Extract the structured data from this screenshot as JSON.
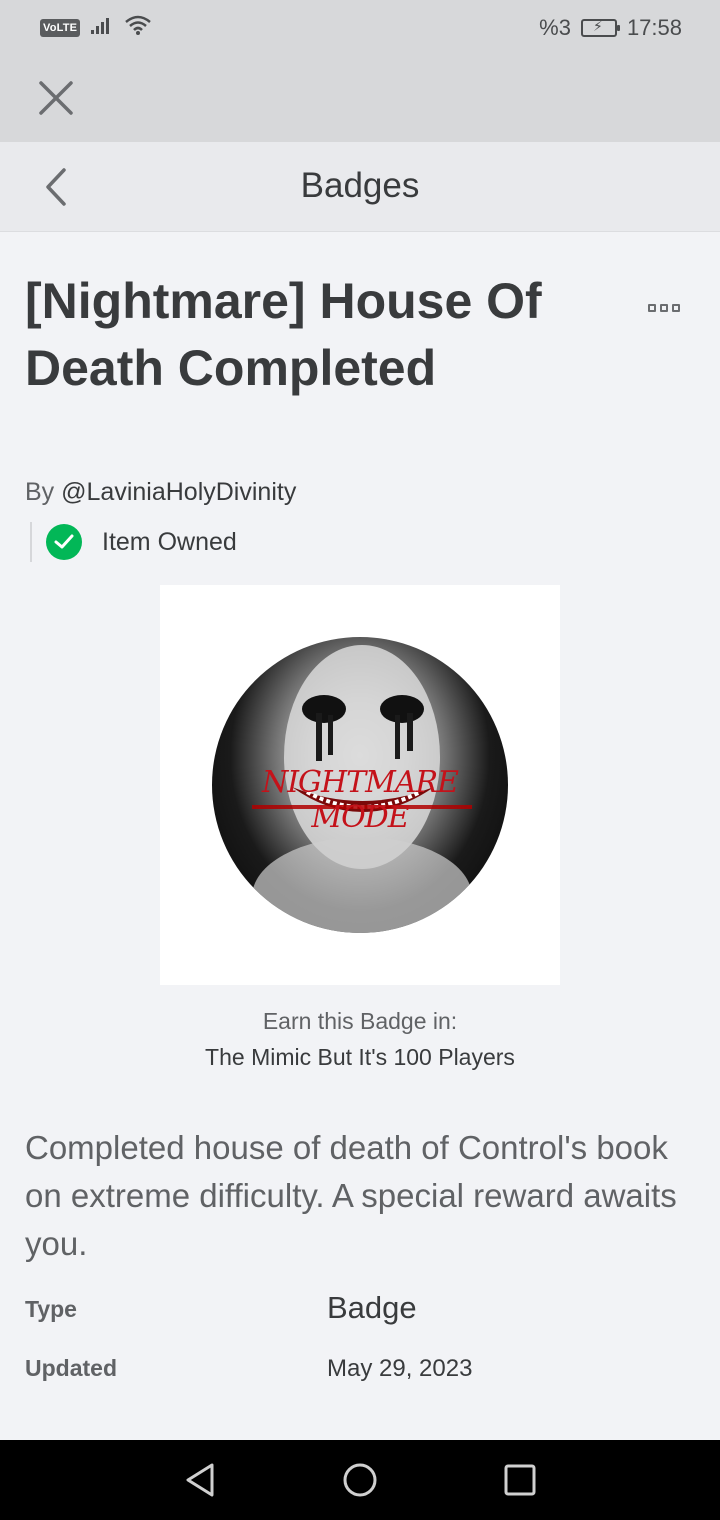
{
  "status_bar": {
    "volte": "VoLTE",
    "battery_percent": "%3",
    "time": "17:58"
  },
  "header": {
    "title": "Badges"
  },
  "badge": {
    "name": "[Nightmare] House Of Death Completed",
    "by_prefix": "By",
    "creator": "@LaviniaHolyDivinity",
    "owned_label": "Item Owned",
    "image_text": "NIGHTMARE MODE",
    "earn_label": "Earn this Badge in:",
    "game_name": "The Mimic But It's 100 Players",
    "description": "Completed house of death of Control's book on extreme difficulty. A special reward awaits you.",
    "details": {
      "type_label": "Type",
      "type_value": "Badge",
      "updated_label": "Updated",
      "updated_value": "May 29, 2023"
    }
  },
  "colors": {
    "owned_check": "#02b757",
    "background": "#f2f3f6",
    "top_bar": "#d7d8da"
  }
}
